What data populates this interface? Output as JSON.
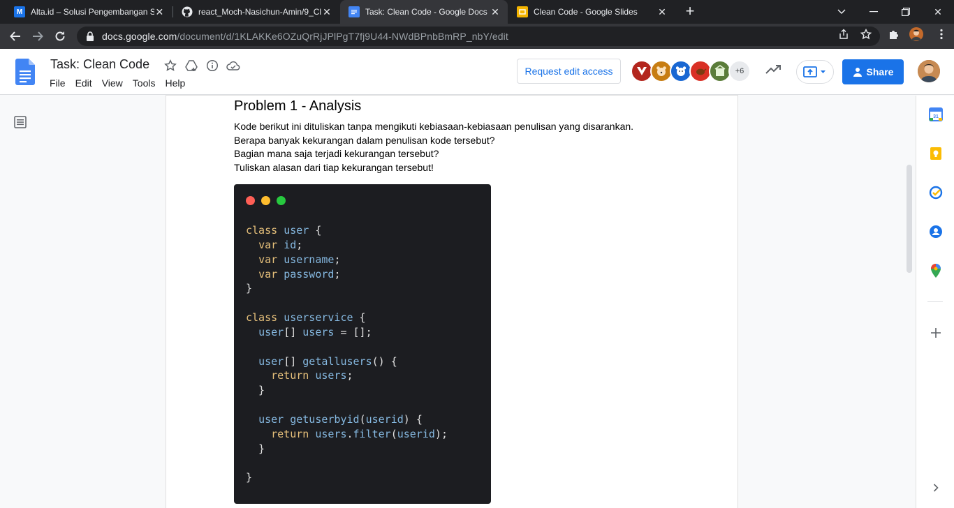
{
  "browser": {
    "tabs": [
      {
        "title": "Alta.id – Solusi Pengembangan Sk",
        "favicon": "m-logo-icon",
        "color": "#1a73e8"
      },
      {
        "title": "react_Moch-Nasichun-Amin/9_Cl",
        "favicon": "github-icon",
        "color": "#ffffff"
      },
      {
        "title": "Task: Clean Code - Google Docs",
        "favicon": "docs-icon",
        "color": "#4285f4"
      },
      {
        "title": "Clean Code - Google Slides",
        "favicon": "slides-icon",
        "color": "#f4b400"
      }
    ],
    "url_host": "docs.google.com",
    "url_path": "/document/d/1KLAKKe6OZuQrRjJPlPgT7fj9U44-NWdBPnbBmRP_nbY/edit"
  },
  "docs": {
    "title": "Task: Clean Code",
    "menu": [
      "File",
      "Edit",
      "View",
      "Tools",
      "Help"
    ],
    "request_edit_label": "Request edit access",
    "more_collaborators": "+6",
    "share_label": "Share",
    "collaborator_colors": [
      "#c5221f",
      "#e37400",
      "#1a73e8",
      "#d93025",
      "#5b8c3a"
    ]
  },
  "document": {
    "heading": "Problem 1 - Analysis",
    "paragraphs": [
      "Kode berikut ini dituliskan tanpa mengikuti kebiasaan-kebiasaan penulisan yang disarankan.",
      "Berapa banyak kekurangan dalam penulisan kode tersebut?",
      "Bagian mana saja terjadi kekurangan tersebut?",
      "Tuliskan alasan dari tiap kekurangan tersebut!"
    ]
  },
  "code_image": {
    "dot_colors": [
      "#ff5f56",
      "#ffbd2e",
      "#27c93f"
    ],
    "tokens": {
      "class": "class",
      "var": "var",
      "return": "return",
      "user": "user",
      "id": "id",
      "username": "username",
      "password": "password",
      "userservice": "userservice",
      "users": "users",
      "getallusers": "getallusers",
      "getuserbyid": "getuserbyid",
      "userid": "userid",
      "filter": "filter"
    }
  }
}
